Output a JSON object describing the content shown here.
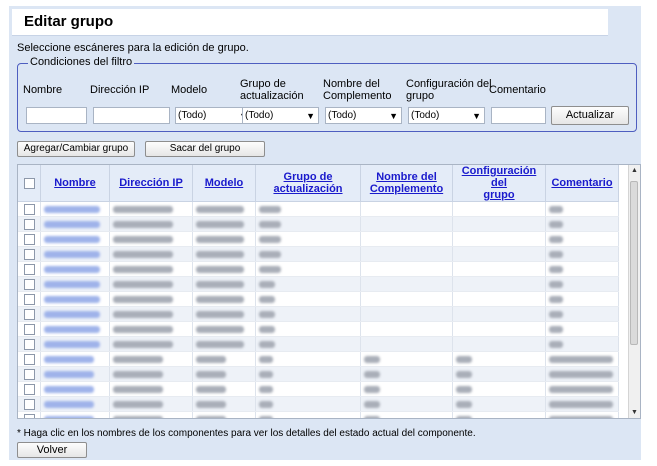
{
  "title": "Editar grupo",
  "intro": "Seleccione escáneres para la edición de grupo.",
  "filter": {
    "legend": "Condiciones del filtro",
    "labels": {
      "nombre": "Nombre",
      "ip": "Dirección IP",
      "modelo": "Modelo",
      "grupo_act_1": "Grupo de",
      "grupo_act_2": "actualización",
      "complemento_1": "Nombre del",
      "complemento_2": "Complemento",
      "config_1": "Configuración del",
      "config_2": "grupo",
      "comentario": "Comentario"
    },
    "select_value": "(Todo)",
    "update_button": "Actualizar"
  },
  "buttons": {
    "add_change": "Agregar/Cambiar grupo",
    "remove": "Sacar del grupo",
    "back": "Volver"
  },
  "table": {
    "headers": {
      "nombre": "Nombre",
      "ip": "Dirección IP",
      "modelo": "Modelo",
      "grupo_1": "Grupo de",
      "grupo_2": "actualización",
      "complemento_1": "Nombre del",
      "complemento_2": "Complemento",
      "config_1": "Configuración del",
      "config_2": "grupo",
      "comentario": "Comentario"
    },
    "row_count": 16
  },
  "footnote": "* Haga clic en los nombres de los componentes para ver los detalles del estado actual del componente.",
  "colors": {
    "panel_bg": "#dce6f4",
    "header_link": "#1a1acc",
    "filter_border": "#4e5ec0"
  }
}
